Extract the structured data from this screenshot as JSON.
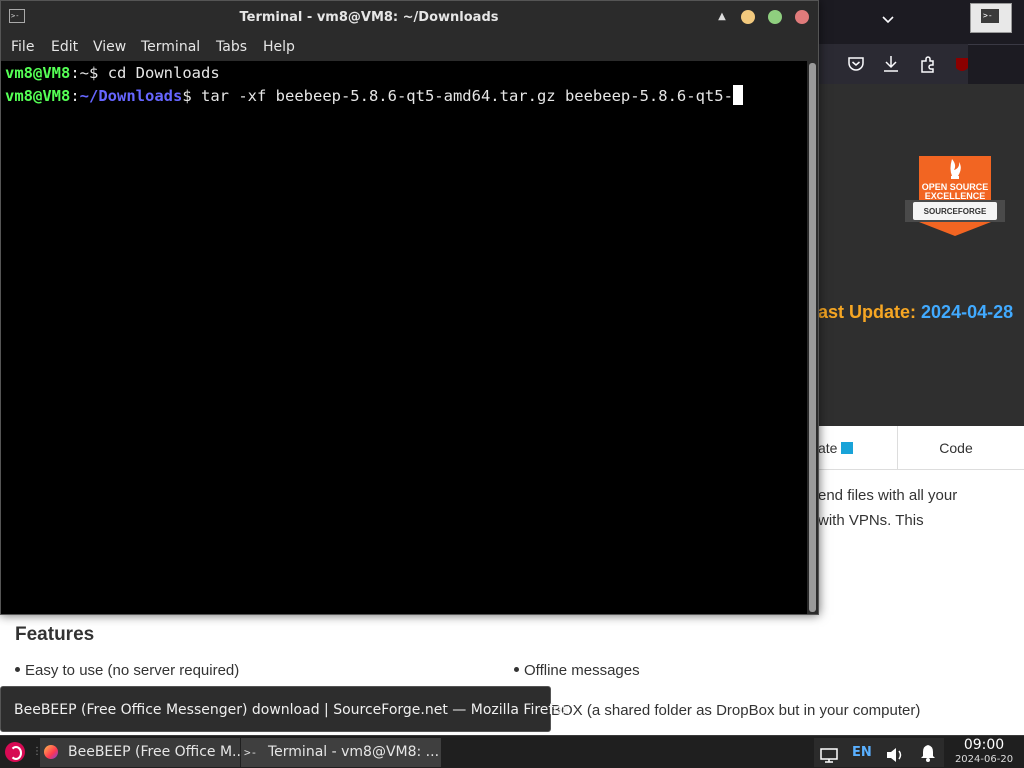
{
  "firefox": {
    "window_title": "BeeBEEP (Free Office Messenger) download | SourceForge.net — Mozilla Firefox",
    "badge": {
      "line1": "OPEN SOURCE",
      "line2": "EXCELLENCE",
      "brand": "SOURCEFORGE"
    },
    "last_update_label": "ast Update:",
    "last_update_date": "2024-04-28",
    "tabs": {
      "update_label": "ate",
      "code_label": "Code"
    },
    "desc_line1": "end files with all your",
    "desc_line2": "with VPNs. This",
    "features_heading": "Features",
    "features": [
      "Easy to use (no server required)",
      "Offline messages",
      "BOX (a shared folder as DropBox but in your computer)"
    ]
  },
  "terminal": {
    "title": "Terminal - vm8@VM8: ~/Downloads",
    "menu": [
      "File",
      "Edit",
      "View",
      "Terminal",
      "Tabs",
      "Help"
    ],
    "lines": [
      {
        "user": "vm8@VM8",
        "sep": ":",
        "path_home": "~",
        "path": "",
        "prompt": "$ ",
        "cmd": "cd Downloads"
      },
      {
        "user": "vm8@VM8",
        "sep": ":",
        "path_home": "",
        "path": "~/Downloads",
        "prompt": "$ ",
        "cmd": "tar -xf beebeep-5.8.6-qt5-amd64.tar.gz beebeep-5.8.6-qt5-"
      }
    ]
  },
  "tooltip": {
    "text": "BeeBEEP (Free Office Messenger) download | SourceForge.net — Mozilla Firefox"
  },
  "taskbar": {
    "firefox_task": "BeeBEEP (Free Office M...",
    "terminal_task": "Terminal - vm8@VM8: ...",
    "terminal_icon_glyph": ">-",
    "language": "EN",
    "time": "09:00",
    "date": "2024-06-20"
  },
  "colors": {
    "terminal_user": "#55ff55",
    "terminal_path": "#6666ff",
    "last_update_label": "#f6a623",
    "last_update_date": "#41aaff",
    "badge_orange": "#f26522",
    "start_button": "#d70a53"
  },
  "icons": {
    "firefox_toolbar": [
      "pocket-icon",
      "download-icon",
      "extensions-icon",
      "ublock-icon"
    ],
    "tray": [
      "display-icon",
      "volume-icon",
      "notification-bell-icon"
    ]
  }
}
